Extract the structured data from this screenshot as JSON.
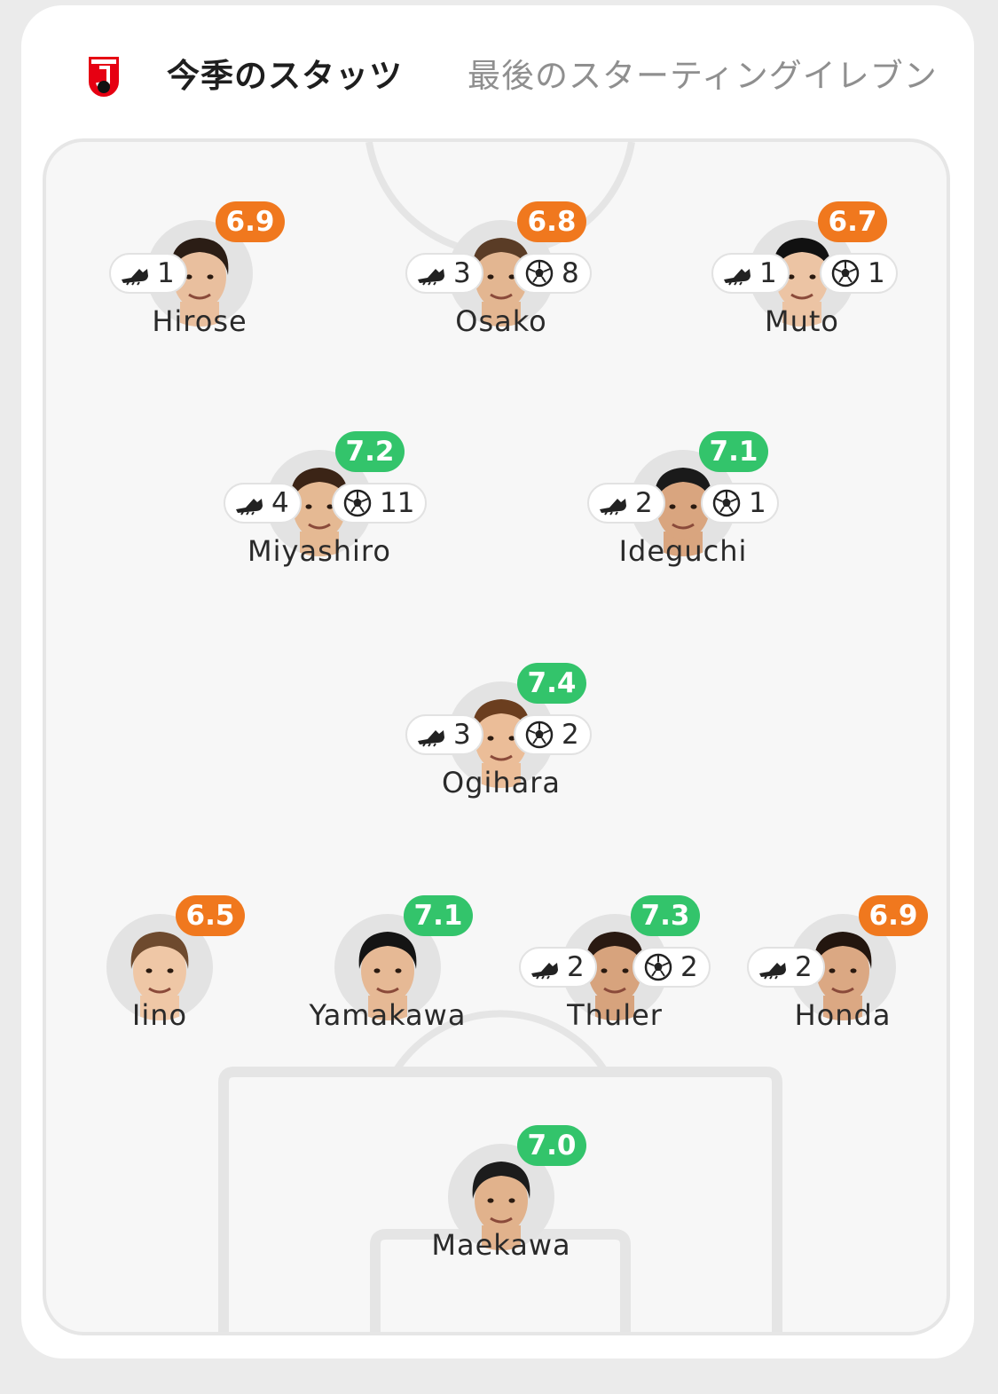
{
  "colors": {
    "rating_orange": "#f0781e",
    "rating_green": "#33c46b",
    "brand_red": "#e60012"
  },
  "header": {
    "logo_icon": "j-league-logo",
    "tabs": [
      {
        "label": "今季のスタッツ",
        "active": true
      },
      {
        "label": "最後のスターティングイレブン",
        "active": false
      }
    ]
  },
  "lineup": {
    "players": [
      {
        "name": "Hirose",
        "rating": "6.9",
        "rating_color": "orange",
        "assists": "1",
        "goals": null
      },
      {
        "name": "Osako",
        "rating": "6.8",
        "rating_color": "orange",
        "assists": "3",
        "goals": "8"
      },
      {
        "name": "Muto",
        "rating": "6.7",
        "rating_color": "orange",
        "assists": "1",
        "goals": "1"
      },
      {
        "name": "Miyashiro",
        "rating": "7.2",
        "rating_color": "green",
        "assists": "4",
        "goals": "11"
      },
      {
        "name": "Ideguchi",
        "rating": "7.1",
        "rating_color": "green",
        "assists": "2",
        "goals": "1"
      },
      {
        "name": "Ogihara",
        "rating": "7.4",
        "rating_color": "green",
        "assists": "3",
        "goals": "2"
      },
      {
        "name": "Iino",
        "rating": "6.5",
        "rating_color": "orange",
        "assists": null,
        "goals": null
      },
      {
        "name": "Yamakawa",
        "rating": "7.1",
        "rating_color": "green",
        "assists": null,
        "goals": null
      },
      {
        "name": "Thuler",
        "rating": "7.3",
        "rating_color": "green",
        "assists": "2",
        "goals": "2"
      },
      {
        "name": "Honda",
        "rating": "6.9",
        "rating_color": "orange",
        "assists": "2",
        "goals": null
      },
      {
        "name": "Maekawa",
        "rating": "7.0",
        "rating_color": "green",
        "assists": null,
        "goals": null
      }
    ],
    "icons": {
      "assist": "football-boot-icon",
      "goal": "soccer-ball-icon"
    }
  }
}
